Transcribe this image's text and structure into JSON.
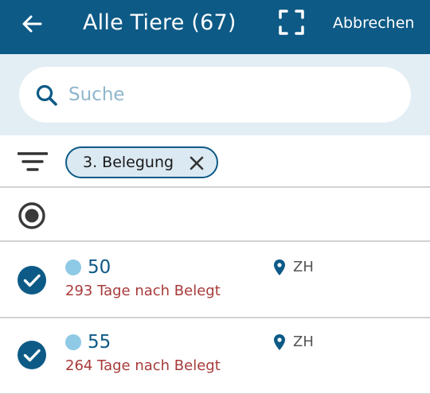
{
  "header": {
    "title": "Alle Tiere (67)",
    "cancel_label": "Abbrechen"
  },
  "search": {
    "placeholder": "Suche",
    "value": ""
  },
  "filter": {
    "chips": [
      {
        "label": "3. Belegung"
      }
    ]
  },
  "animals": [
    {
      "number": "50",
      "status_text": "293 Tage nach Belegt",
      "location": "ZH",
      "selected": true,
      "dot_color": "#8ecae6"
    },
    {
      "number": "55",
      "status_text": "264 Tage nach Belegt",
      "location": "ZH",
      "selected": true,
      "dot_color": "#8ecae6"
    }
  ],
  "colors": {
    "header_bg": "#0d5a86",
    "accent": "#0d5a86",
    "status_text": "#a83a3a",
    "search_area_bg": "#e3eef4"
  },
  "icons": {
    "back": "arrow-left-icon",
    "scan": "scan-frame-icon",
    "search": "search-icon",
    "filter": "filter-icon",
    "chip_close": "close-icon",
    "select_all": "radio-selected-icon",
    "row_check": "check-circle-icon",
    "location": "location-pin-icon"
  }
}
